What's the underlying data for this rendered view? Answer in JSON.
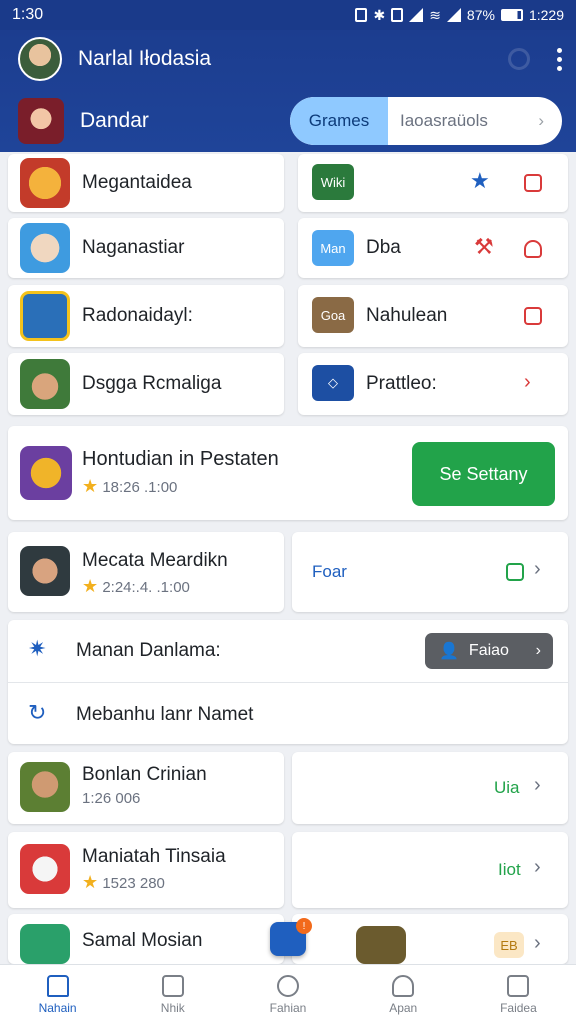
{
  "status_bar": {
    "time": "1:30",
    "battery": "87%",
    "clock": "1:229"
  },
  "header": {
    "title": "Narlal Iłodasia",
    "subtitle": "Dandar"
  },
  "segment": {
    "active": "Grames",
    "inactive": "Iaoasraüols"
  },
  "rows": [
    {
      "left_title": "Megantaidea",
      "right_label": ""
    },
    {
      "left_title": "Naganastiar",
      "right_square": "Man",
      "right_label": "Dba"
    },
    {
      "left_title": "Radonaidayl:",
      "right_square": "Goa",
      "right_label": "Nahulean"
    },
    {
      "left_title": "Dsgga Rcmaliga",
      "right_label": "Prattleo:"
    }
  ],
  "featured": {
    "title": "Hontudian in Pestaten",
    "meta": "18:26  .1:00",
    "button": "Se Settany"
  },
  "item1": {
    "title": "Mecata Meardikn",
    "meta": "2:24:.4.  .1:00",
    "right": "Foar"
  },
  "section": {
    "title": "Manan Danlama:",
    "button": "Faiao",
    "subtitle": "Mebanhu lanr Namet"
  },
  "item2": {
    "title": "Bonlan Crinian",
    "meta": "1:26  006",
    "right": "Uia"
  },
  "item3": {
    "title": "Maniatah Tinsaia",
    "meta": "1523  280",
    "right": "Iiot"
  },
  "item4": {
    "title": "Samal Mosian",
    "badge": "!",
    "right_square": "EB"
  },
  "tabs": [
    {
      "label": "Nahain",
      "active": true
    },
    {
      "label": "Nhik",
      "active": false
    },
    {
      "label": "Fahian",
      "active": false
    },
    {
      "label": "Apan",
      "active": false
    },
    {
      "label": "Faidea",
      "active": false
    }
  ],
  "colors": {
    "header_bg": "#1c3d8f",
    "accent": "#1f5fbf",
    "green": "#22a34a",
    "danger": "#d93a3a"
  }
}
